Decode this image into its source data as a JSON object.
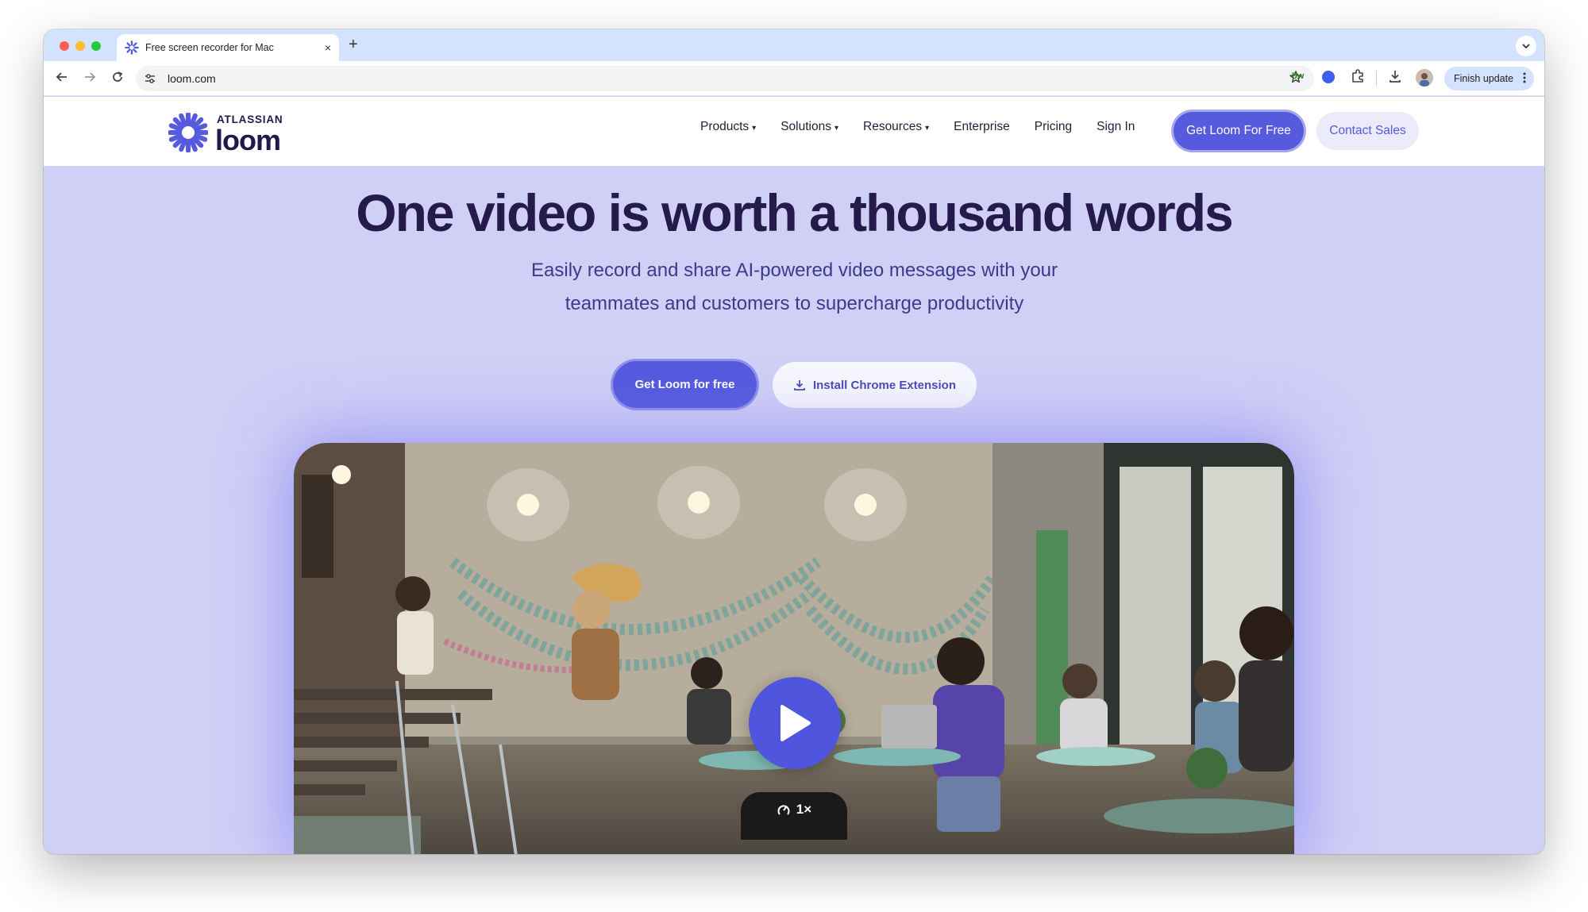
{
  "browser": {
    "tab_title": "Free screen recorder for Mac",
    "tab_close": "×",
    "new_tab": "+",
    "url": "loom.com",
    "finish_update": "Finish update",
    "extension_bw": "bw"
  },
  "header": {
    "logo_brand": "ATLASSIAN",
    "logo_name": "loom",
    "nav": [
      {
        "label": "Products",
        "caret": "▾"
      },
      {
        "label": "Solutions",
        "caret": "▾"
      },
      {
        "label": "Resources",
        "caret": "▾"
      },
      {
        "label": "Enterprise"
      },
      {
        "label": "Pricing"
      },
      {
        "label": "Sign In"
      }
    ],
    "primary_button": "Get Loom For Free",
    "secondary_button": "Contact Sales"
  },
  "hero": {
    "title": "One video is worth a thousand words",
    "subtitle": "Easily record and share AI-powered video messages with your teammates and customers to supercharge productivity",
    "cta_primary": "Get Loom for free",
    "cta_secondary": "Install Chrome Extension"
  },
  "video": {
    "speed": "1×"
  },
  "colors": {
    "brand": "#565add",
    "hero_bg": "#d0cff6",
    "heading": "#241a4b",
    "subtitle": "#3b3a8f"
  },
  "icons": [
    "back-arrow-icon",
    "forward-arrow-icon",
    "reload-icon",
    "site-info-icon",
    "star-icon",
    "puzzle-icon",
    "download-icon",
    "play-icon",
    "speed-icon",
    "loom-burst-icon"
  ]
}
